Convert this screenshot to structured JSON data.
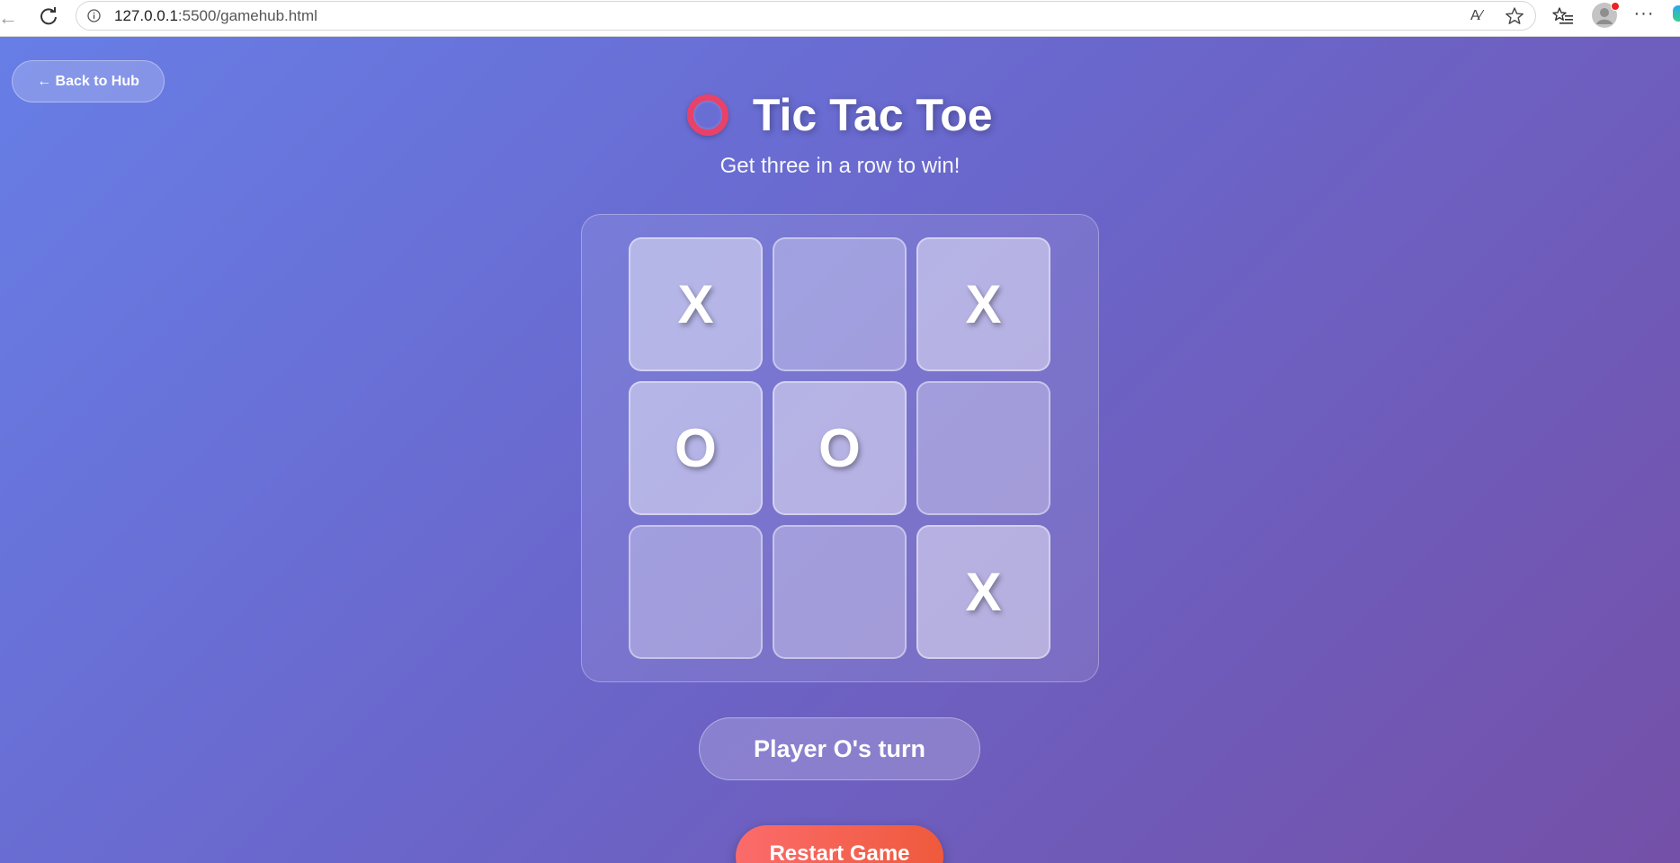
{
  "browser": {
    "url_host": "127.0.0.1",
    "url_path": ":5500/gamehub.html",
    "icons": {
      "back": "back-arrow-icon",
      "refresh": "refresh-icon",
      "site_info": "info-icon",
      "read_aloud": "read-aloud-icon",
      "favorite": "star-icon",
      "favorites": "favorites-icon",
      "profile": "profile-icon",
      "more": "more-icon"
    },
    "read_aloud_glyph": "A⁄",
    "more_glyph": "···"
  },
  "page": {
    "back_label": "← Back to Hub",
    "title": "Tic Tac Toe",
    "title_icon": "heavy-circle-emoji",
    "subtitle": "Get three in a row to win!",
    "board": [
      [
        "X",
        "",
        "X"
      ],
      [
        "O",
        "O",
        ""
      ],
      [
        "",
        "",
        "X"
      ]
    ],
    "status": "Player O's turn",
    "restart_label": "Restart Game",
    "colors": {
      "gradient_start": "#677ee6",
      "gradient_end": "#7450a8",
      "restart_start": "#fb6b6b",
      "restart_end": "#ef5a3c",
      "circle_emoji": "#e8426a"
    }
  }
}
